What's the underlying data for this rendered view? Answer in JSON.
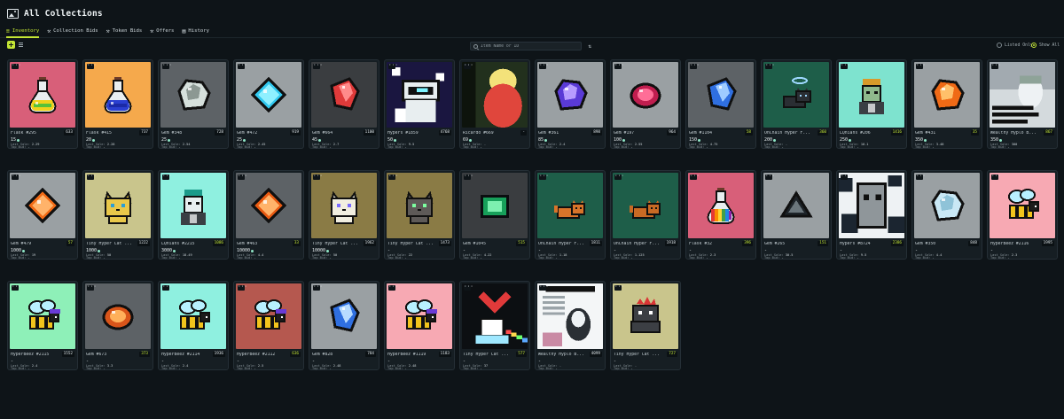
{
  "header": {
    "title": "All Collections",
    "icon": "image-icon"
  },
  "tabs": [
    {
      "label": "Inventory",
      "icon": "db-icon",
      "active": true
    },
    {
      "label": "Collection Bids",
      "icon": "gavel-icon",
      "active": false
    },
    {
      "label": "Token Bids",
      "icon": "gavel-icon",
      "active": false
    },
    {
      "label": "Offers",
      "icon": "gavel-icon",
      "active": false
    },
    {
      "label": "History",
      "icon": "book-icon",
      "active": false
    }
  ],
  "search": {
    "placeholder": "Item Name or ID"
  },
  "filters": {
    "listed_only": "Listed Only",
    "show_all": "Show All",
    "selected": "show_all"
  },
  "labels": {
    "last_sale": "Last Sale:",
    "top_bid": "Top Bid:"
  },
  "colors": {
    "accent": "#c4e635",
    "background": "#0e1418",
    "card": "#161e23",
    "hype": "#8fe6c6"
  },
  "items": [
    {
      "name": "Flask #295",
      "rank": "633",
      "price": "15",
      "last_sale": "2.29",
      "top_bid": "-",
      "art": "flask-green",
      "bg": "#d85f79"
    },
    {
      "name": "Flask #415",
      "rank": "737",
      "price": "20",
      "last_sale": "2.28",
      "top_bid": "-",
      "art": "flask-blue",
      "bg": "#f5a94c"
    },
    {
      "name": "Gem #348",
      "rank": "728",
      "price": "25",
      "last_sale": "2.54",
      "top_bid": "-",
      "art": "gem-grey",
      "bg": "#5d6266"
    },
    {
      "name": "Gem #472",
      "rank": "919",
      "price": "25",
      "last_sale": "2.45",
      "top_bid": "-",
      "art": "gem-cyan",
      "bg": "#9aa0a3"
    },
    {
      "name": "Gem #664",
      "rank": "1100",
      "price": "45",
      "last_sale": "2.7",
      "top_bid": "-",
      "art": "gem-red",
      "bg": "#3a3d40"
    },
    {
      "name": "Hypers #1859",
      "rank": "4768",
      "price": "50",
      "last_sale": "9.5",
      "top_bid": "-",
      "art": "hyper-robot",
      "bg": "#1a1640"
    },
    {
      "name": "Ricardo #669",
      "rank": "-",
      "price": "69",
      "last_sale": "-",
      "top_bid": "-",
      "art": "ricardo",
      "bg": "#2a3a22"
    },
    {
      "name": "Gem #361",
      "rank": "898",
      "price": "85",
      "last_sale": "2.4",
      "top_bid": "-",
      "art": "gem-purple",
      "bg": "#9aa0a3"
    },
    {
      "name": "Gem #197",
      "rank": "964",
      "price": "100",
      "last_sale": "2.55",
      "top_bid": "-",
      "art": "gem-ruby",
      "bg": "#9aa0a3"
    },
    {
      "name": "Gem #1104",
      "rank": "58",
      "rank_green": true,
      "price": "150",
      "last_sale": "4.75",
      "top_bid": "-",
      "art": "gem-blue",
      "bg": "#5d6266"
    },
    {
      "name": "OnChain Hyper F...",
      "rank": "360",
      "rank_green": true,
      "price": "200",
      "last_sale": "-",
      "top_bid": "-",
      "art": "cat-halo",
      "bg": "#1e5e49"
    },
    {
      "name": "LQnians #206",
      "rank": "1416",
      "rank_green": true,
      "price": "250",
      "last_sale": "10.1",
      "top_bid": "-",
      "art": "lqnian-skull",
      "bg": "#7ee3cf"
    },
    {
      "name": "Gem #431",
      "rank": "35",
      "rank_green": true,
      "price": "350",
      "last_sale": "3.48",
      "top_bid": "-",
      "art": "gem-orange",
      "bg": "#9aa0a3"
    },
    {
      "name": "Wealthy Hyplo B...",
      "rank": "867",
      "rank_green": true,
      "price": "350",
      "last_sale": "300",
      "top_bid": "-",
      "art": "wealthy-meme",
      "bg": "#c9d0d4"
    },
    {
      "name": "Gem #479",
      "rank": "57",
      "rank_green": true,
      "price": "1000",
      "last_sale": "19",
      "top_bid": "-",
      "art": "gem-orange2",
      "bg": "#9aa0a3"
    },
    {
      "name": "Tiny Hyper Cat ...",
      "rank": "1222",
      "price": "1000",
      "last_sale": "50",
      "top_bid": "-",
      "art": "cat-yellow",
      "bg": "#c9c58c"
    },
    {
      "name": "LQnians #2215",
      "rank": "1086",
      "rank_green": true,
      "price": "3000",
      "last_sale": "18.49",
      "top_bid": "-",
      "art": "lqnian-cat",
      "bg": "#8ff0e0"
    },
    {
      "name": "Gem #463",
      "rank": "33",
      "rank_green": true,
      "price": "10000",
      "last_sale": "4.4",
      "top_bid": "-",
      "art": "gem-orange3",
      "bg": "#5d6266"
    },
    {
      "name": "Tiny Hyper Cat ...",
      "rank": "1962",
      "price": "10000",
      "last_sale": "50",
      "top_bid": "-",
      "art": "cat-white",
      "bg": "#8a7b45"
    },
    {
      "name": "Tiny Hyper Cat ...",
      "rank": "1473",
      "price": "-",
      "last_sale": "22",
      "top_bid": "-",
      "art": "cat-grey",
      "bg": "#8a7b45"
    },
    {
      "name": "Gem #1045",
      "rank": "515",
      "rank_green": true,
      "price": "-",
      "last_sale": "4.22",
      "top_bid": "-",
      "art": "gem-emerald",
      "bg": "#3a3d40"
    },
    {
      "name": "OnChain Hyper F...",
      "rank": "1811",
      "price": "-",
      "last_sale": "1.18",
      "top_bid": "-",
      "art": "cat-orange",
      "bg": "#1e5e49"
    },
    {
      "name": "OnChain Hyper F...",
      "rank": "1918",
      "price": "-",
      "last_sale": "1.125",
      "top_bid": "-",
      "art": "cat-orange2",
      "bg": "#1e5e49"
    },
    {
      "name": "Flask #32",
      "rank": "396",
      "rank_green": true,
      "price": "-",
      "last_sale": "2.3",
      "top_bid": "-",
      "art": "flask-rainbow",
      "bg": "#d85f79"
    },
    {
      "name": "Gem #265",
      "rank": "151",
      "rank_green": true,
      "price": "-",
      "last_sale": "30.5",
      "top_bid": "-",
      "art": "gem-dark",
      "bg": "#9aa0a3"
    },
    {
      "name": "Hypers #8724",
      "rank": "2386",
      "rank_green": true,
      "price": "-",
      "last_sale": "9.5",
      "top_bid": "-",
      "art": "hyper-stone",
      "bg": "#eef2f4"
    },
    {
      "name": "Gem #350",
      "rank": "848",
      "price": "-",
      "last_sale": "4.4",
      "top_bid": "-",
      "art": "gem-ice",
      "bg": "#9aa0a3"
    },
    {
      "name": "HyperBeez #2116",
      "rank": "1995",
      "price": "-",
      "last_sale": "2.3",
      "top_bid": "-",
      "art": "bee",
      "bg": "#f7a9b3"
    },
    {
      "name": "HyperBeez #2115",
      "rank": "1552",
      "price": "-",
      "last_sale": "2.4",
      "top_bid": "-",
      "art": "bee-cap",
      "bg": "#8ef0b8"
    },
    {
      "name": "Gem #673",
      "rank": "373",
      "rank_green": true,
      "price": "-",
      "last_sale": "3.3",
      "top_bid": "-",
      "art": "gem-amber",
      "bg": "#5d6266"
    },
    {
      "name": "HyperBeez #2114",
      "rank": "1936",
      "price": "-",
      "last_sale": "2.4",
      "top_bid": "-",
      "art": "bee-dark",
      "bg": "#8ff0e0"
    },
    {
      "name": "HyperBeez #2112",
      "rank": "636",
      "rank_green": true,
      "price": "-",
      "last_sale": "2.5",
      "top_bid": "-",
      "art": "bee-red",
      "bg": "#b5584f"
    },
    {
      "name": "Gem #828",
      "rank": "784",
      "price": "-",
      "last_sale": "2.48",
      "top_bid": "-",
      "art": "gem-sapphire",
      "bg": "#9aa0a3"
    },
    {
      "name": "HyperBeez #1119",
      "rank": "1183",
      "price": "-",
      "last_sale": "2.48",
      "top_bid": "-",
      "art": "bee-pink",
      "bg": "#f7a9b3"
    },
    {
      "name": "Tiny Hyper Cat ...",
      "rank": "577",
      "rank_green": true,
      "price": "-",
      "last_sale": "37",
      "top_bid": "-",
      "art": "cat-heart",
      "bg": "#0c0f12"
    },
    {
      "name": "Wealthy Hyplo B...",
      "rank": "4099",
      "price": "-",
      "last_sale": "-",
      "top_bid": "-",
      "art": "salt-sheet",
      "bg": "#e9ecee"
    },
    {
      "name": "Tiny Hyper Cat ...",
      "rank": "727",
      "rank_green": true,
      "price": "-",
      "last_sale": "-",
      "top_bid": "-",
      "art": "cat-punk",
      "bg": "#c9c58c"
    }
  ]
}
